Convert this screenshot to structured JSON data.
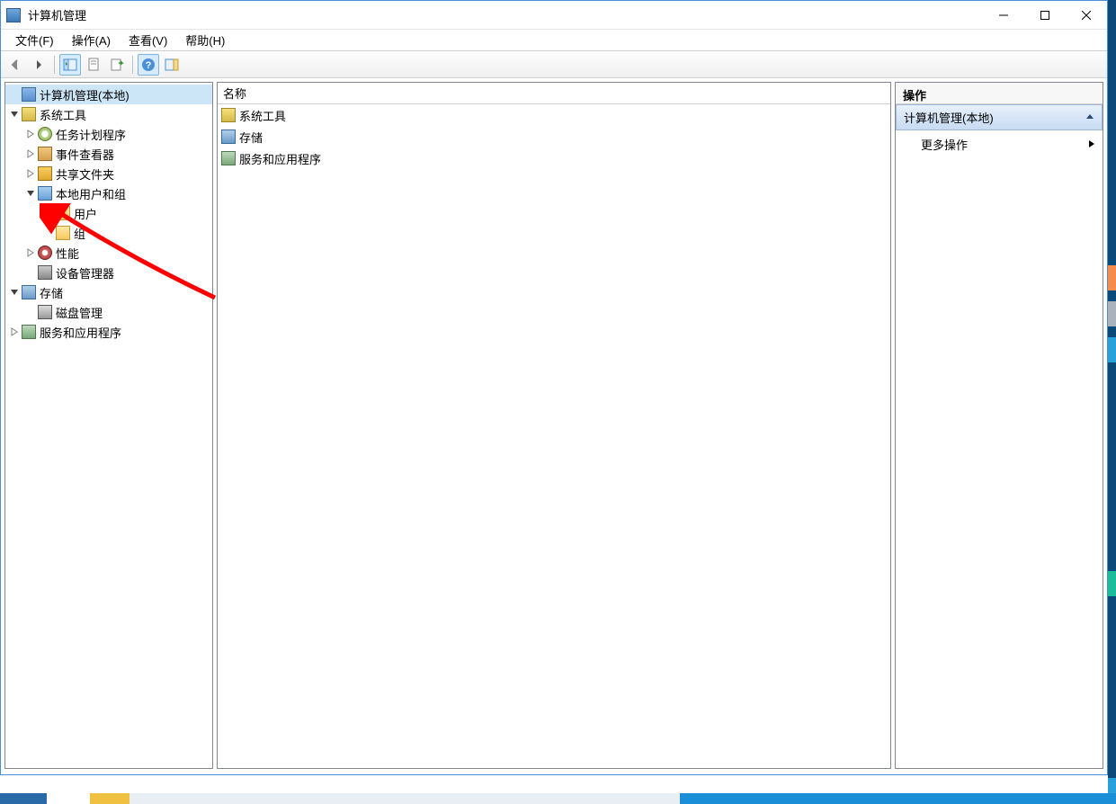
{
  "window": {
    "title": "计算机管理"
  },
  "menu": {
    "file": "文件(F)",
    "action": "操作(A)",
    "view": "查看(V)",
    "help": "帮助(H)"
  },
  "tree": {
    "root": "计算机管理(本地)",
    "system_tools": "系统工具",
    "task_scheduler": "任务计划程序",
    "event_viewer": "事件查看器",
    "shared_folders": "共享文件夹",
    "local_users_groups": "本地用户和组",
    "users": "用户",
    "groups": "组",
    "performance": "性能",
    "device_manager": "设备管理器",
    "storage": "存储",
    "disk_management": "磁盘管理",
    "services_apps": "服务和应用程序"
  },
  "list": {
    "column_name": "名称",
    "items": {
      "system_tools": "系统工具",
      "storage": "存储",
      "services_apps": "服务和应用程序"
    }
  },
  "actions": {
    "header": "操作",
    "section_title": "计算机管理(本地)",
    "more_actions": "更多操作"
  }
}
